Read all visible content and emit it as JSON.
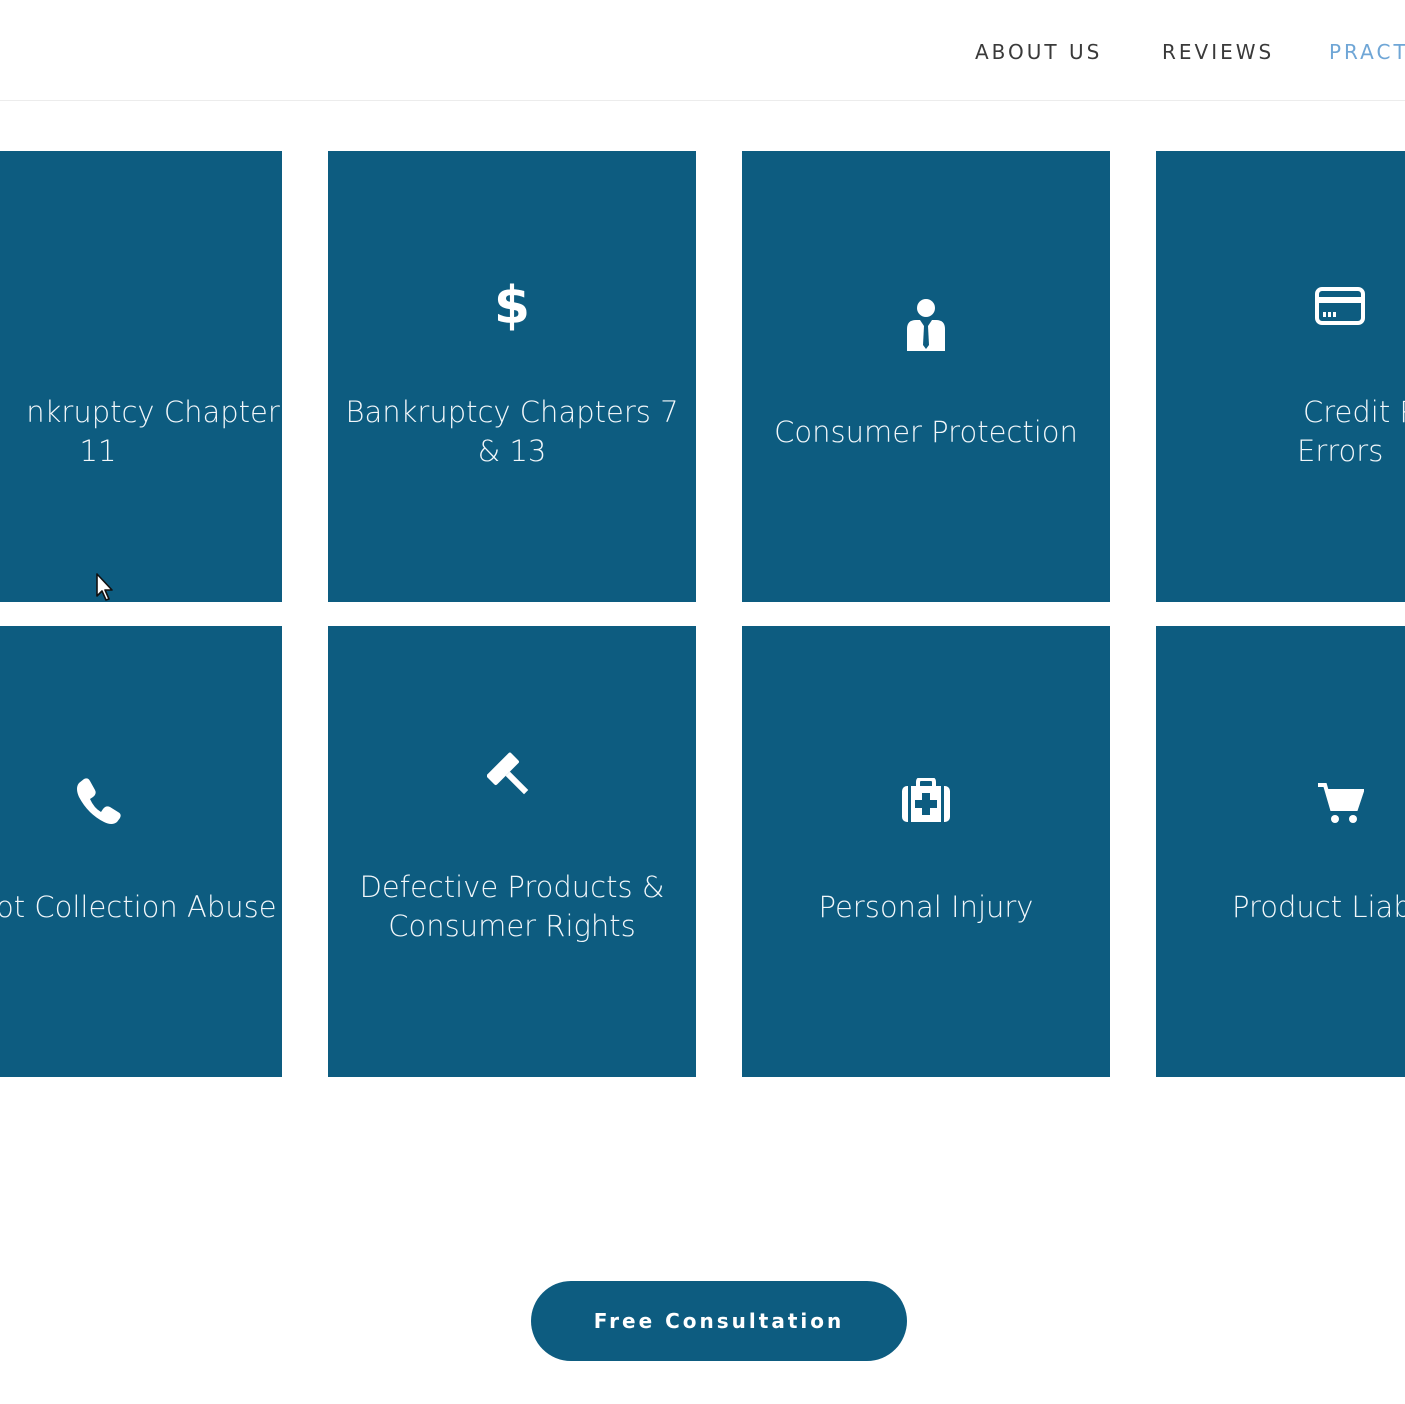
{
  "nav": {
    "about": "ABOUT US",
    "reviews": "REVIEWS",
    "practice": "PRACT"
  },
  "cards": [
    {
      "label_line1": "nkruptcy Chapter",
      "label_line2": "11",
      "icon": "dollar-icon"
    },
    {
      "label_line1": "Bankruptcy Chapters 7",
      "label_line2": "& 13",
      "icon": "dollar-icon"
    },
    {
      "label_line1": "Consumer Protection",
      "icon": "businessman-icon"
    },
    {
      "label_line1": "Credit Report",
      "label_line2": "Errors",
      "icon": "credit-card-icon"
    },
    {
      "label_line1": "ot Collection Abuse",
      "icon": "phone-icon"
    },
    {
      "label_line1": "Defective Products &",
      "label_line2": "Consumer Rights",
      "icon": "gavel-icon"
    },
    {
      "label_line1": "Personal Injury",
      "icon": "medical-kit-icon"
    },
    {
      "label_line1": "Product Liab",
      "icon": "shopping-cart-icon"
    }
  ],
  "icons": {
    "dollar": "$"
  },
  "cta": {
    "label": "Free Consultation"
  },
  "colors": {
    "card_bg": "#0d5c80",
    "nav_active": "#6fa6d6",
    "nav_text": "#3a3a3a"
  }
}
